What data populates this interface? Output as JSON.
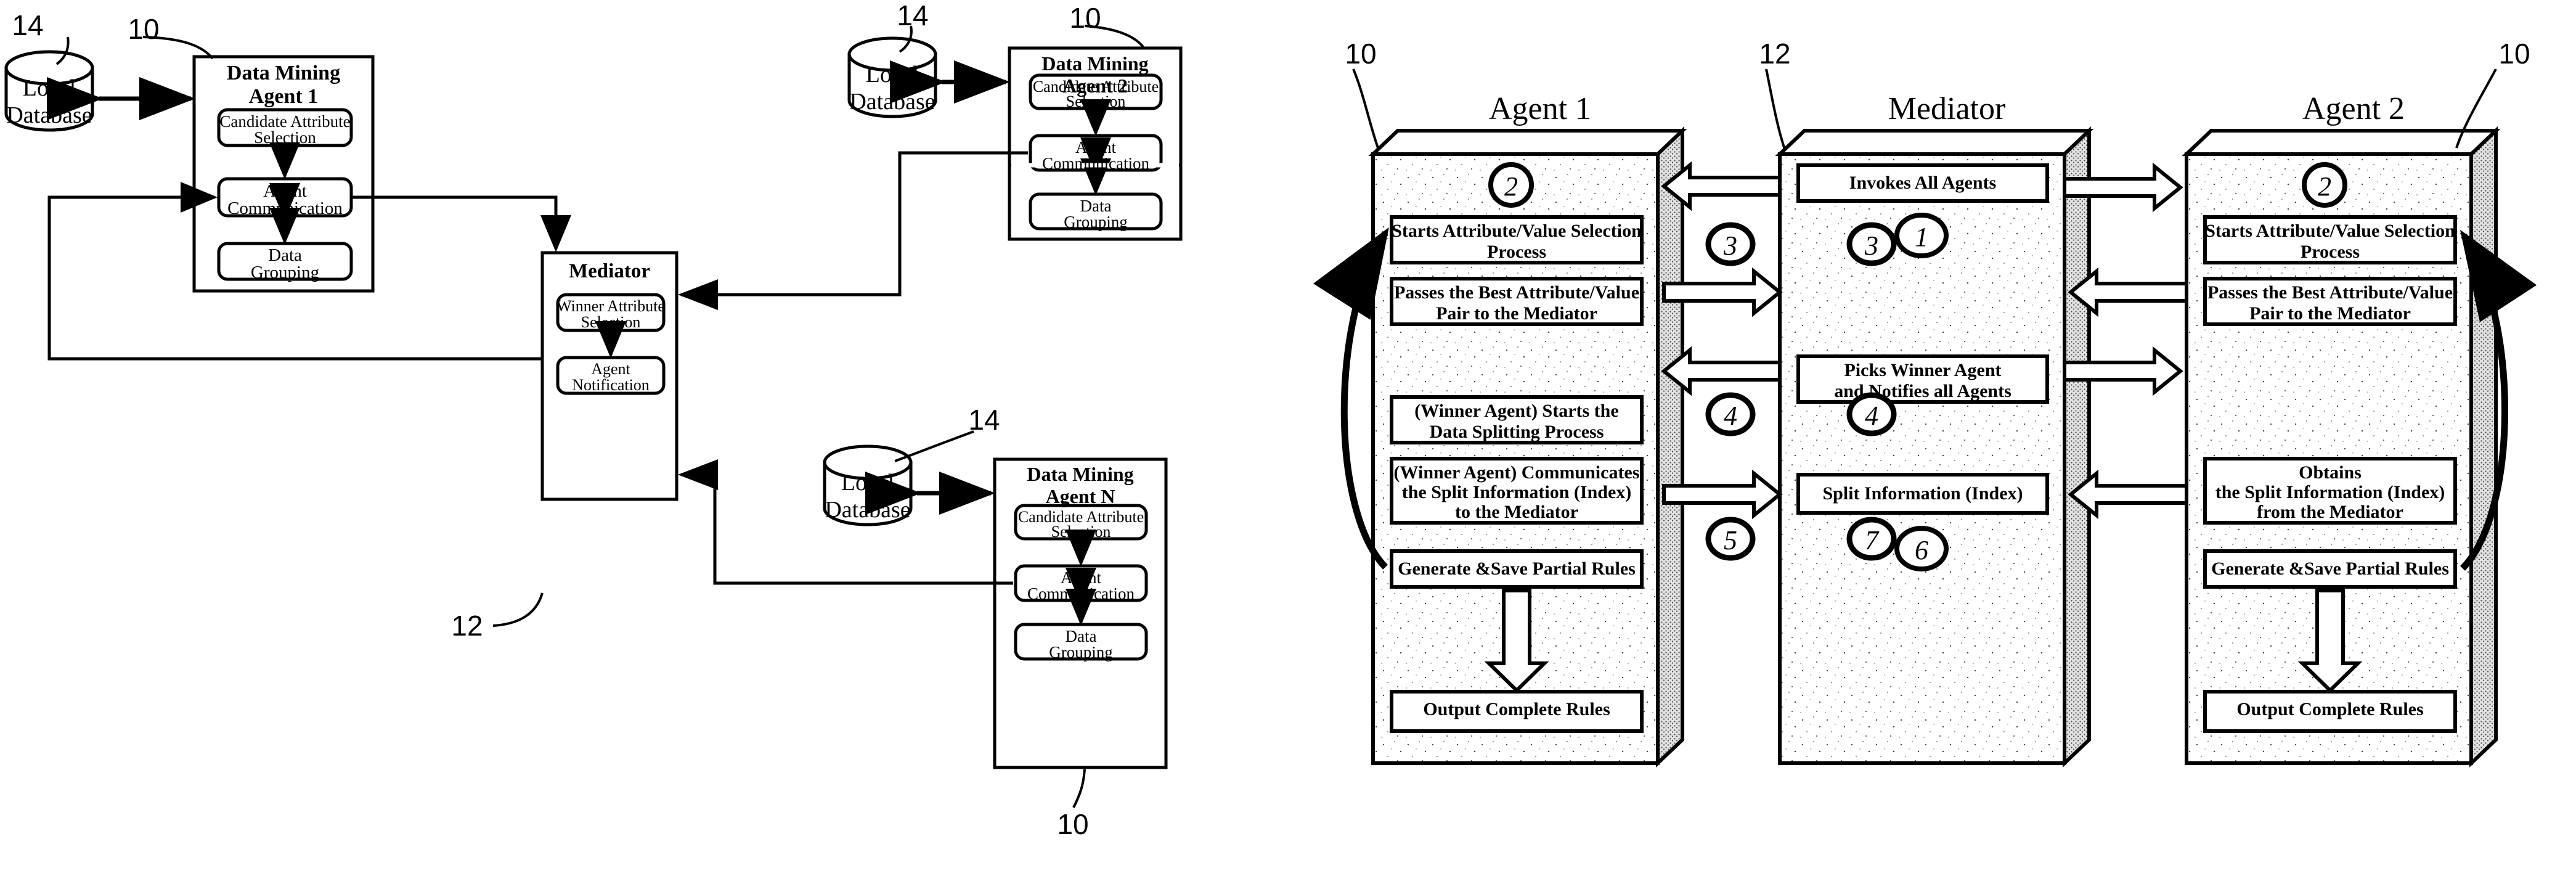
{
  "figure": {
    "left_diagram": {
      "reference_labels": [
        "14",
        "10",
        "14",
        "10",
        "14",
        "10",
        "12"
      ],
      "agents": [
        {
          "title": "Data Mining\nAgent 1",
          "title_line1": "Data Mining",
          "title_line2": "Agent 1",
          "ref": "10",
          "db_label_line1": "Local",
          "db_label_line2": "Database",
          "db_ref": "14",
          "modules": [
            {
              "line1": "Candidate Attribute",
              "line2": "Selection"
            },
            {
              "line1": "Agent",
              "line2": "Communication"
            },
            {
              "line1": "Data",
              "line2": "Grouping"
            }
          ]
        },
        {
          "title_line1": "Data Mining",
          "title_line2": "Agent 2",
          "ref": "10",
          "db_label_line1": "Local",
          "db_label_line2": "Database",
          "db_ref": "14",
          "modules": [
            {
              "line1": "Candidate Attribute",
              "line2": "Selection"
            },
            {
              "line1": "Agent",
              "line2": "Communication"
            },
            {
              "line1": "Data",
              "line2": "Grouping"
            }
          ]
        },
        {
          "title_line1": "Data Mining",
          "title_line2": "Agent N",
          "ref": "10",
          "db_label_line1": "Local",
          "db_label_line2": "Database",
          "db_ref": "14",
          "modules": [
            {
              "line1": "Candidate Attribute",
              "line2": "Selection"
            },
            {
              "line1": "Agent",
              "line2": "Communication"
            },
            {
              "line1": "Data",
              "line2": "Grouping"
            }
          ]
        }
      ],
      "mediator": {
        "title": "Mediator",
        "ref": "12",
        "modules": [
          {
            "line1": "Winner Attribute",
            "line2": "Selection"
          },
          {
            "line1": "Agent",
            "line2": "Notification"
          }
        ]
      }
    },
    "right_diagram": {
      "columns": [
        {
          "header": "Agent 1",
          "ref": "10",
          "circle_number": "2",
          "steps": [
            {
              "line1": "Starts Attribute/Value Selection",
              "line2": "Process"
            },
            {
              "line1": "Passes the Best Attribute/Value",
              "line2": "Pair to the Mediator"
            },
            {
              "line1": "(Winner Agent) Starts the",
              "line2": "Data Splitting Process"
            },
            {
              "line1": "(Winner Agent) Communicates",
              "line2": "the Split Information (Index)",
              "line3": "to the Mediator"
            },
            {
              "line1": "Generate &Save Partial Rules"
            },
            {
              "line1": "Output Complete Rules"
            }
          ]
        },
        {
          "header": "Mediator",
          "ref": "12",
          "circle_number_top": "1",
          "circle_number_bottom": "6",
          "steps": [
            {
              "line1": "Invokes All Agents"
            },
            {
              "line1": "Picks Winner Agent",
              "line2": "and Notifies all Agents"
            },
            {
              "line1": "Split Information (Index)"
            }
          ]
        },
        {
          "header": "Agent 2",
          "ref": "10",
          "circle_number": "2",
          "steps": [
            {
              "line1": "Starts Attribute/Value Selection",
              "line2": "Process"
            },
            {
              "line1": "Passes the Best Attribute/Value",
              "line2": "Pair to the Mediator"
            },
            {
              "line1": "Obtains",
              "line2": "the Split Information (Index)",
              "line3": "from the Mediator"
            },
            {
              "line1": "Generate &Save Partial Rules"
            },
            {
              "line1": "Output Complete Rules"
            }
          ]
        }
      ],
      "flow_numbers_left": [
        "3",
        "4",
        "5"
      ],
      "flow_numbers_right": [
        "3",
        "4",
        "7"
      ]
    }
  }
}
